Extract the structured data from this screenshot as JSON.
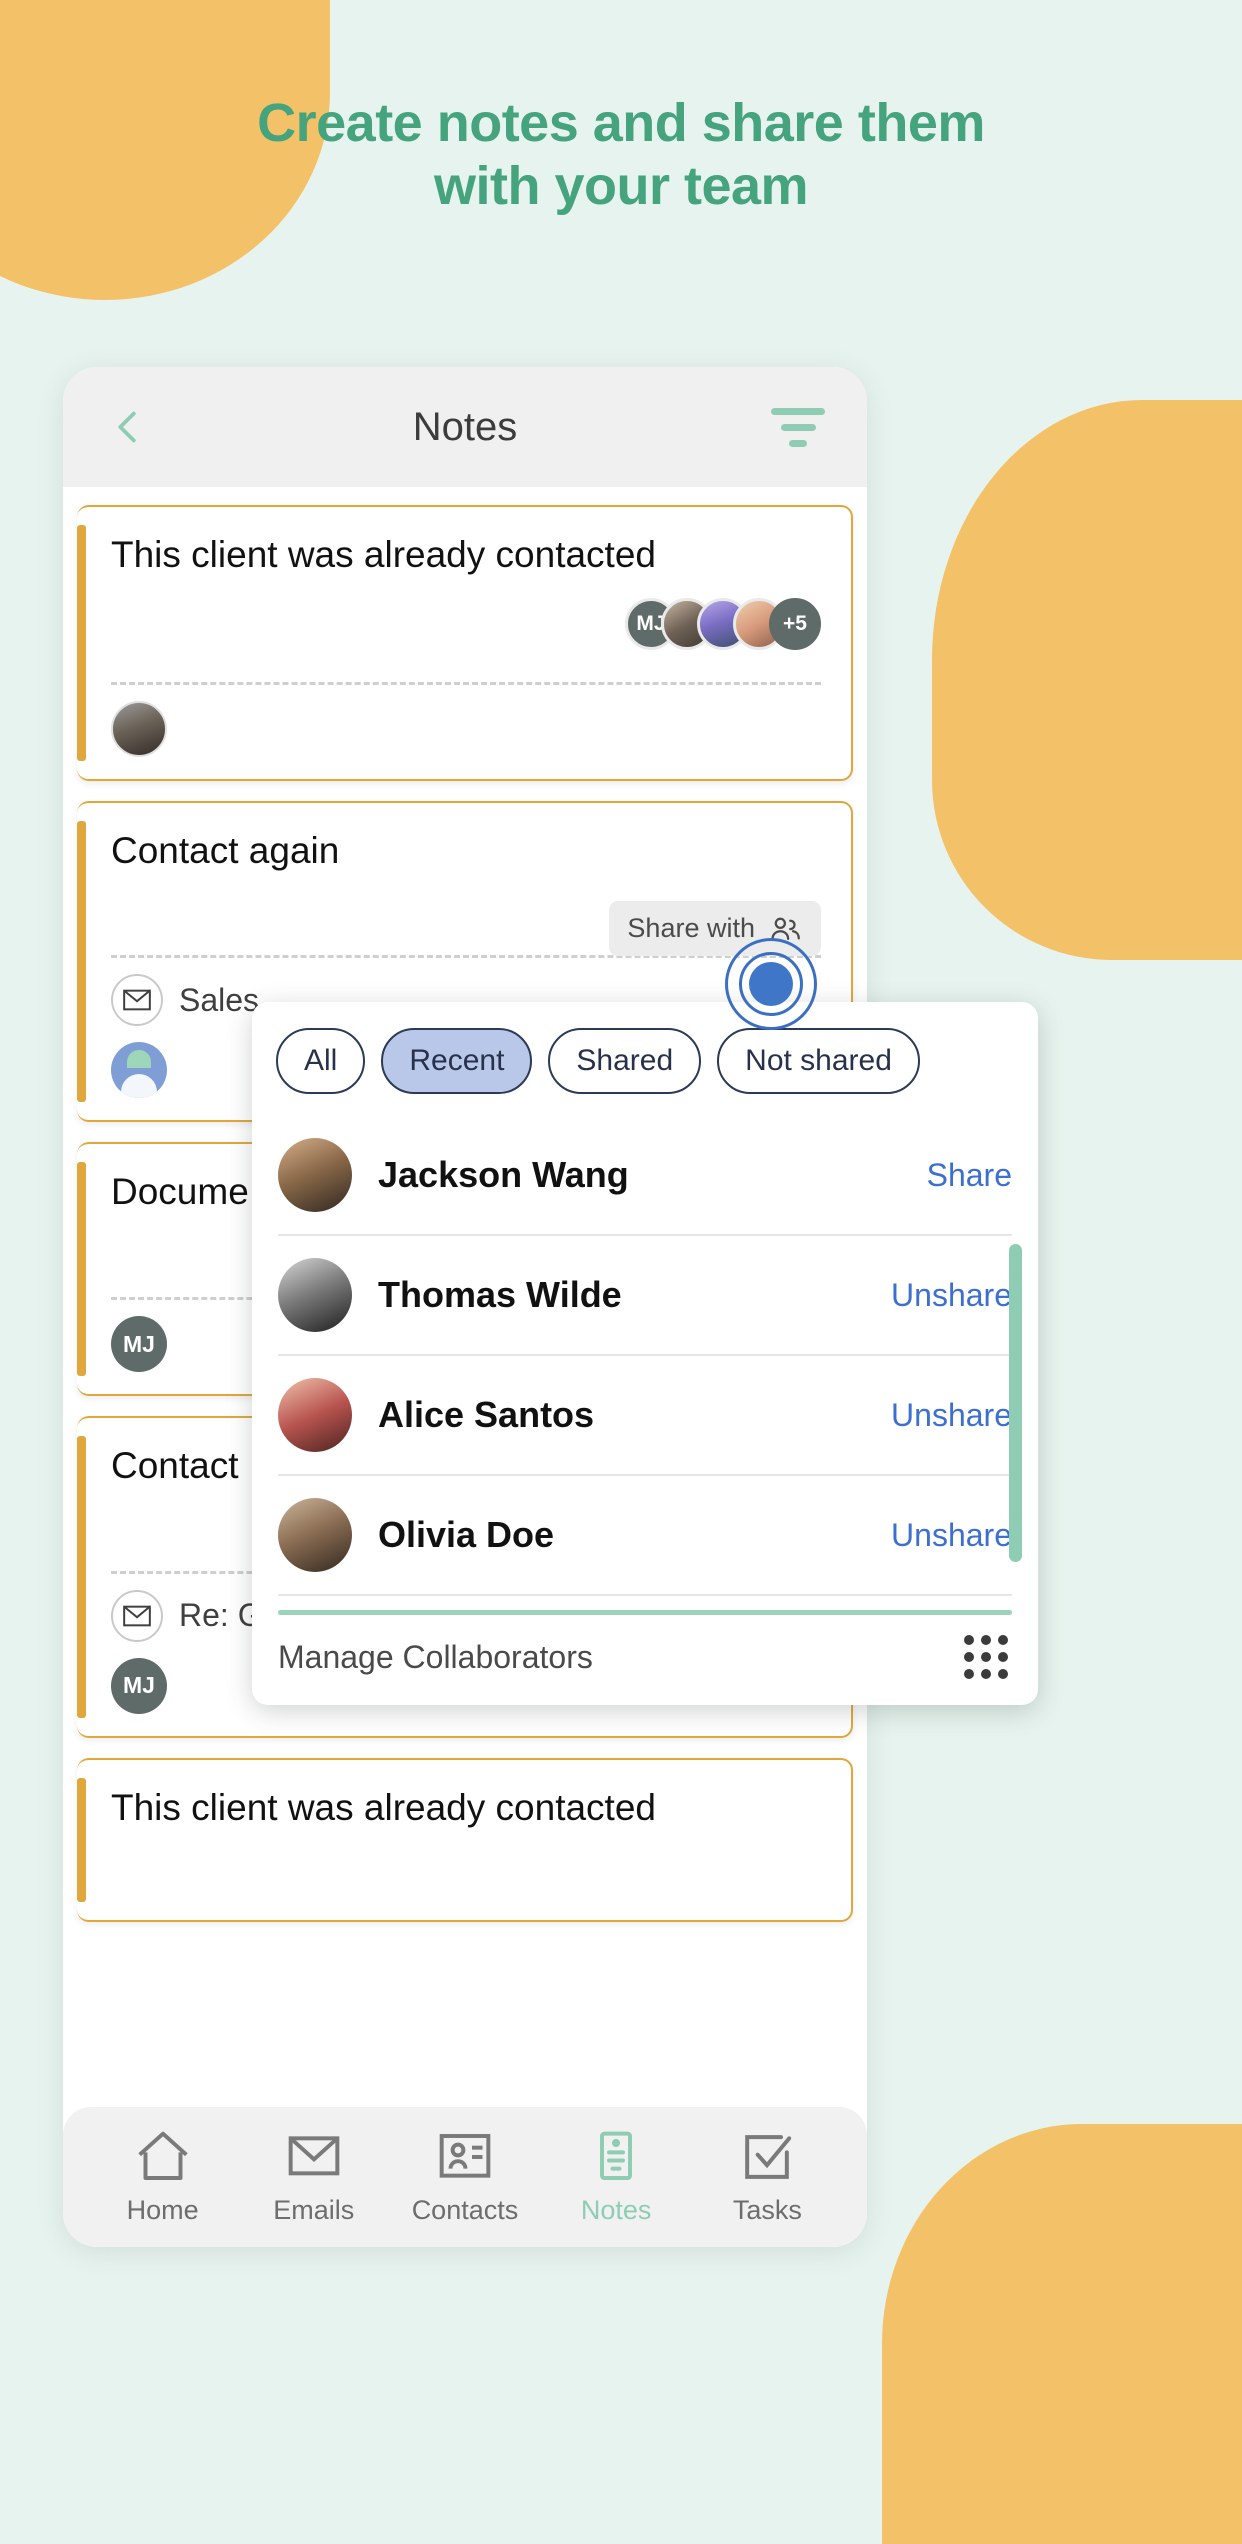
{
  "headline": {
    "line1": "Create notes and share them",
    "line2": "with your team"
  },
  "colors": {
    "background": "#e7f3ee",
    "accent_green": "#45a37d",
    "blob_orange": "#f3c167",
    "card_border": "#e0a83c",
    "link_blue": "#3d6fd0",
    "chip_active": "#b9c7e8",
    "scrollbar": "#8ecdb4"
  },
  "phone": {
    "header": {
      "back_icon": "chevron-left-icon",
      "title": "Notes",
      "filter_icon": "filter-lines-icon"
    },
    "notes": [
      {
        "title": "This client was already contacted",
        "avatars": [
          "MJ",
          "",
          "",
          ""
        ],
        "overflow_count": "+5",
        "owner_avatar": "photo-avatar"
      },
      {
        "title": "Contact again",
        "share_with_label": "Share with",
        "share_with_icon": "people-icon",
        "meta_icon": "mail-icon",
        "meta_text": "Sales",
        "owner_avatar": "blue-avatar"
      },
      {
        "title": "Docume",
        "owner_initials": "MJ"
      },
      {
        "title": "Contact",
        "meta_icon": "mail-icon",
        "meta_text": "Re: G",
        "owner_initials": "MJ"
      },
      {
        "title": "This client was already contacted"
      }
    ],
    "bottom_nav": [
      {
        "label": "Home",
        "icon": "home-icon",
        "active": false
      },
      {
        "label": "Emails",
        "icon": "envelope-icon",
        "active": false
      },
      {
        "label": "Contacts",
        "icon": "contact-card-icon",
        "active": false
      },
      {
        "label": "Notes",
        "icon": "note-icon",
        "active": true
      },
      {
        "label": "Tasks",
        "icon": "checkbox-icon",
        "active": false
      }
    ]
  },
  "share_popup": {
    "filters": [
      {
        "label": "All",
        "active": false
      },
      {
        "label": "Recent",
        "active": true
      },
      {
        "label": "Shared",
        "active": false
      },
      {
        "label": "Not shared",
        "active": false
      }
    ],
    "people": [
      {
        "name": "Jackson Wang",
        "action": "Share"
      },
      {
        "name": "Thomas Wilde",
        "action": "Unshare"
      },
      {
        "name": "Alice Santos",
        "action": "Unshare"
      },
      {
        "name": "Olivia Doe",
        "action": "Unshare"
      }
    ],
    "footer_label": "Manage Collaborators",
    "footer_icon": "grid-dots-icon"
  }
}
